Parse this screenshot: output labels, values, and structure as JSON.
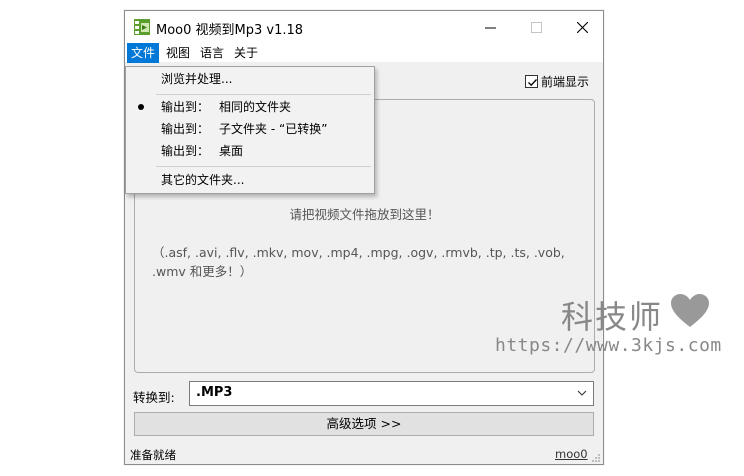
{
  "window": {
    "title": "Moo0 视频到Mp3 v1.18",
    "min_symbol": "—",
    "max_symbol": "☐",
    "close_symbol": "✕"
  },
  "menubar": {
    "items": [
      {
        "label": "文件",
        "active": true
      },
      {
        "label": "视图",
        "active": false
      },
      {
        "label": "语言",
        "active": false
      },
      {
        "label": "关于",
        "active": false
      }
    ]
  },
  "file_menu": {
    "browse": "浏览并处理...",
    "output_same": "输出到：相同的文件夹",
    "output_same_prefix": "输出到：",
    "output_same_value": "相同的文件夹",
    "output_sub_prefix": "输出到：",
    "output_sub_value": "子文件夹 - “已转换”",
    "output_desktop_prefix": "输出到：",
    "output_desktop_value": "桌面",
    "other_folder": "其它的文件夹...",
    "selected": "output_same"
  },
  "preview": {
    "label": "前端显示",
    "checked": true
  },
  "dropzone": {
    "hint": "请把视频文件拖放到这里！",
    "types": "（.asf, .avi, .flv, .mkv, mov, .mp4, .mpg, .ogv, .rmvb, .tp, .ts, .vob, .wmv 和更多！）"
  },
  "convert": {
    "label": "转换到:",
    "value": ".MP3"
  },
  "advanced_button": "高级选项 >>",
  "status": {
    "text": "准备就绪",
    "link": "moo0"
  },
  "watermark": {
    "name": "科技师",
    "url": "https://www.3kjs.com"
  },
  "colors": {
    "accent": "#0078d7",
    "heart": "#999999"
  }
}
